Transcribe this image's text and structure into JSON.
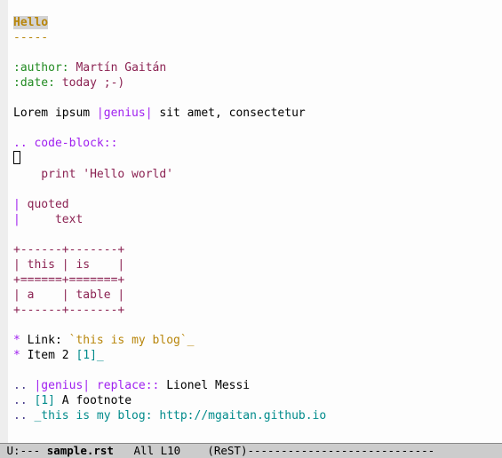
{
  "content": {
    "title": "Hello",
    "title_underline": "-----",
    "author_field": ":author:",
    "author_value": " Martín Gaitán",
    "date_field": ":date:",
    "date_value": " today ;-)",
    "lorem_pre": "Lorem ipsum ",
    "lorem_subst": "|genius|",
    "lorem_post": " sit amet, consectetur",
    "codeblock_dir": ".. code-block::",
    "codeblock_bang": "!",
    "codeblock_code": "    print 'Hello world'",
    "quoted_l1_bar": "|",
    "quoted_l1_txt": " quoted",
    "quoted_l2_bar": "|",
    "quoted_l2_txt": "     text",
    "table_l1": "+------+-------+",
    "table_l2": "| this | is    |",
    "table_l3": "+======+=======+",
    "table_l4": "| a    | table |",
    "table_l5": "+------+-------+",
    "list1_bullet": "*",
    "list1_pre": " Link: ",
    "list1_ref": "`this is my blog`_",
    "list2_bullet": "*",
    "list2_pre": " Item 2 ",
    "list2_foot": "[1]_",
    "def_subst_dots": ".. ",
    "def_subst_name": "|genius|",
    "def_subst_dir": " replace::",
    "def_subst_val": " Lionel Messi",
    "footnote_dots": ".. ",
    "footnote_ref": "[1]",
    "footnote_txt": " A footnote",
    "target_dots": ".. ",
    "target_name": "_this is my blog:",
    "target_url": " http://mgaitan.github.io"
  },
  "modeline": {
    "left": "U:--- ",
    "buffer": "sample.rst",
    "pos": "   All L10   ",
    "mode": " (ReST)",
    "dashes": "----------------------------"
  }
}
